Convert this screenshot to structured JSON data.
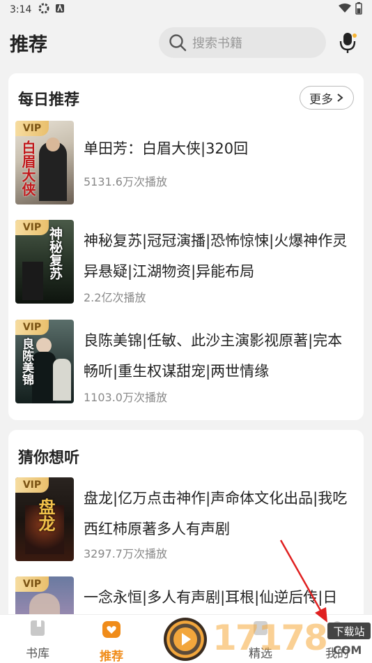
{
  "status": {
    "time": "3:14"
  },
  "header": {
    "title": "推荐",
    "search_placeholder": "搜索书籍"
  },
  "daily": {
    "title": "每日推荐",
    "more_label": "更多",
    "items": [
      {
        "title": "单田芳：白眉大侠|320回",
        "plays": "5131.6万次播放",
        "cover_text": "白眉大侠",
        "vip": "VIP"
      },
      {
        "title": "神秘复苏|冠冠演播|恐怖惊悚|火爆神作灵异悬疑|江湖物资|异能布局",
        "plays": "2.2亿次播放",
        "cover_text": "神秘复苏",
        "vip": "VIP"
      },
      {
        "title": "良陈美锦|任敏、此沙主演影视原著|完本畅听|重生权谋甜宠|两世情缘",
        "plays": "1103.0万次播放",
        "cover_text": "良陈美锦",
        "vip": "VIP"
      }
    ]
  },
  "guess": {
    "title": "猜你想听",
    "items": [
      {
        "title": "盘龙|亿万点击神作|声命体文化出品|我吃西红柿原著多人有声剧",
        "plays": "3297.7万次播放",
        "cover_text": "盘龙",
        "vip": "VIP"
      },
      {
        "title": "一念永恒|多人有声剧|耳根|仙逆后传|日",
        "plays": "",
        "cover_text": "",
        "vip": "VIP"
      }
    ]
  },
  "nav": {
    "library": "书库",
    "recommend": "推荐",
    "selected": "精选",
    "mine": "我的"
  },
  "watermark": {
    "digits": "17178",
    "badge": "下载站",
    "suffix": "COM"
  },
  "colors": {
    "accent": "#f08c1a",
    "vip_gold": "#e9bf6c",
    "arrow": "#e02020"
  }
}
